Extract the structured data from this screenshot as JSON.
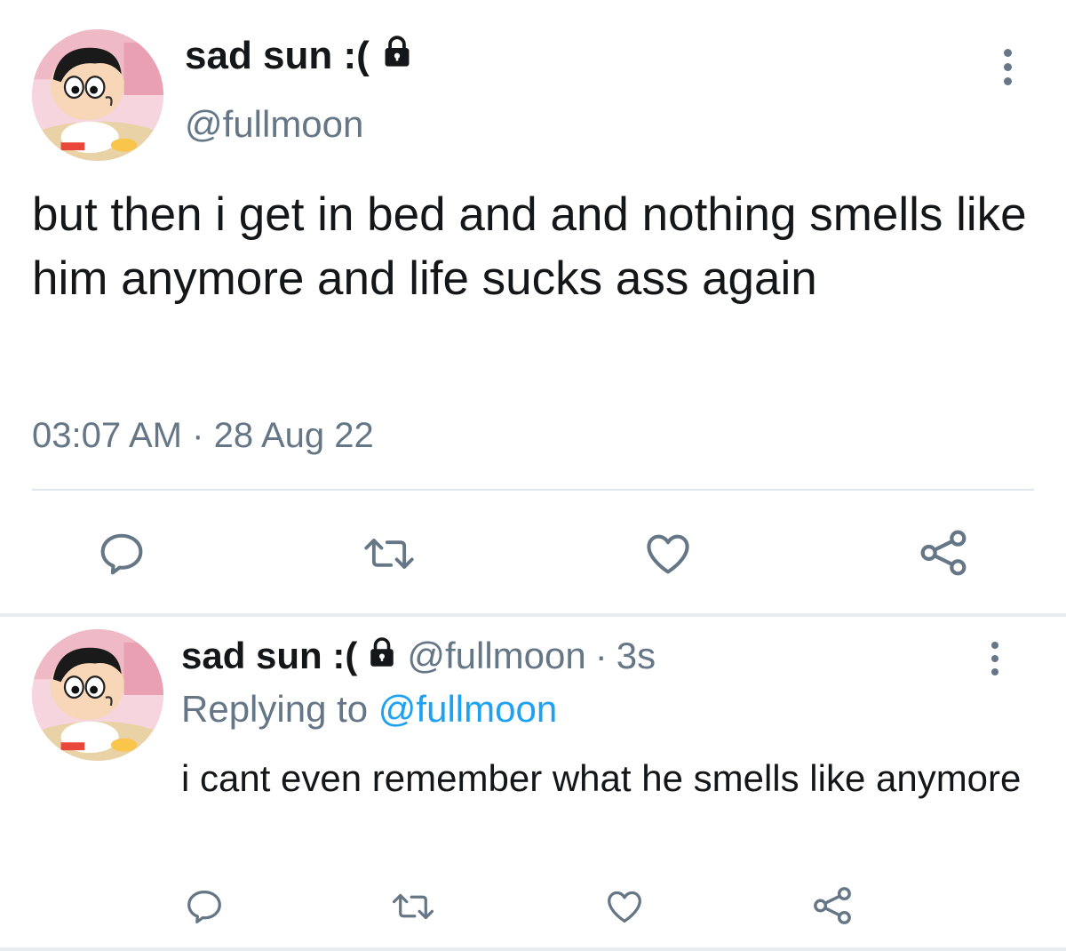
{
  "tweet": {
    "display_name": "sad sun :(",
    "handle": "@fullmoon",
    "text": "but then i get in bed and and nothing smells like him anymore and life sucks ass again",
    "time": "03:07 AM",
    "separator": "·",
    "date": "28 Aug 22",
    "icons": {
      "lock": "lock-icon",
      "more": "more-vertical-icon",
      "reply": "reply-icon",
      "retweet": "retweet-icon",
      "like": "heart-icon",
      "share": "share-icon"
    }
  },
  "reply": {
    "display_name": "sad sun :(",
    "handle": "@fullmoon",
    "separator": "·",
    "time_ago": "3s",
    "replying_prefix": "Replying to",
    "replying_to": "@fullmoon",
    "text": "i cant even remember what he smells like anymore"
  },
  "colors": {
    "text": "#14171a",
    "secondary": "#657786",
    "link": "#1da1f2",
    "divider": "#e1e8ed"
  }
}
